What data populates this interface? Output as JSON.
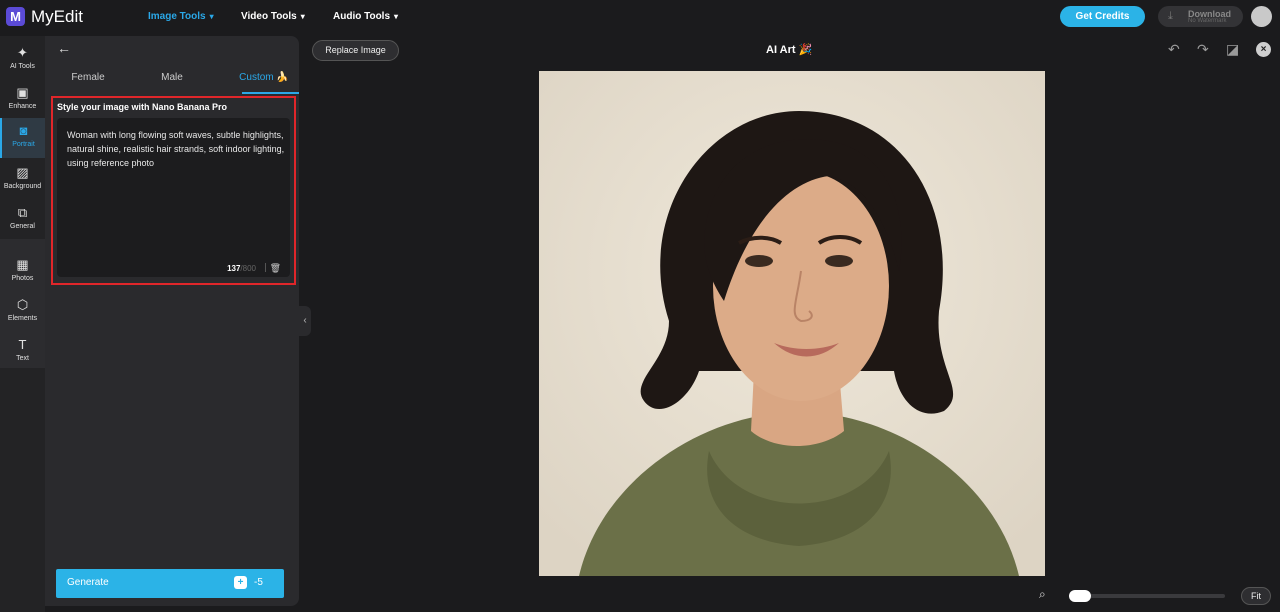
{
  "app": {
    "logo_letter": "M",
    "name": "MyEdit"
  },
  "nav": [
    {
      "label": "Image Tools",
      "active": true
    },
    {
      "label": "Video Tools",
      "active": false
    },
    {
      "label": "Audio Tools",
      "active": false
    }
  ],
  "header": {
    "credits_label": "Get Credits",
    "download_label": "Download",
    "download_sub": "No Watermark"
  },
  "rail": [
    {
      "label": "AI Tools",
      "icon": "magic-wand-icon",
      "glyph": "✦"
    },
    {
      "label": "Enhance",
      "icon": "image-enhance-icon",
      "glyph": "▣"
    },
    {
      "label": "Portrait",
      "icon": "portrait-icon",
      "glyph": "◙"
    },
    {
      "label": "Background",
      "icon": "background-icon",
      "glyph": "▨"
    },
    {
      "label": "General",
      "icon": "general-icon",
      "glyph": "⧉"
    },
    {
      "label": "Photos",
      "icon": "photos-icon",
      "glyph": "▦"
    },
    {
      "label": "Elements",
      "icon": "elements-icon",
      "glyph": "⬡"
    },
    {
      "label": "Text",
      "icon": "text-icon",
      "glyph": "T"
    }
  ],
  "panel": {
    "tabs": [
      {
        "label": "Female"
      },
      {
        "label": "Male"
      },
      {
        "label": "Custom 🍌"
      }
    ],
    "prompt_title": "Style your image with Nano Banana Pro",
    "prompt_text": "Woman with long flowing soft waves, subtle highlights, natural shine, realistic hair strands, soft indoor lighting, using reference photo",
    "char_count": "137",
    "char_max": "/800",
    "generate_label": "Generate",
    "generate_cost": "-5"
  },
  "canvas": {
    "replace_label": "Replace Image",
    "title": "AI Art 🎉",
    "fit_label": "Fit",
    "zoom_level": 0
  },
  "colors": {
    "accent": "#2aa8e8",
    "highlight_border": "#e0262a",
    "button": "#2bb3e7"
  }
}
